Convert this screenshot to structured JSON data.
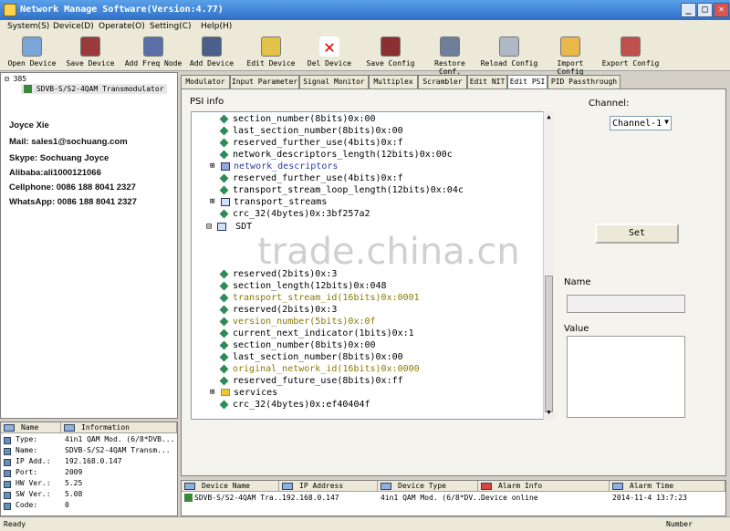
{
  "window": {
    "title": "Network Manage Software(Version:4.77)"
  },
  "menu": [
    "System(S)",
    "Device(D)",
    "Operate(O)",
    "Setting(C)",
    "Help(H)"
  ],
  "toolbar": [
    {
      "label": "Open Device",
      "icon": "open-device-icon"
    },
    {
      "label": "Save Device",
      "icon": "save-device-icon"
    },
    {
      "label": "Add Freq Node",
      "icon": "add-freq-node-icon"
    },
    {
      "label": "Add Device",
      "icon": "add-device-icon"
    },
    {
      "label": "Edit Device",
      "icon": "edit-device-icon"
    },
    {
      "label": "Del Device",
      "icon": "delete-icon"
    },
    {
      "label": "Save Config",
      "icon": "save-config-icon"
    },
    {
      "label": "Restore Conf.",
      "icon": "restore-config-icon"
    },
    {
      "label": "Reload Config",
      "icon": "reload-config-icon"
    },
    {
      "label": "Import Config",
      "icon": "import-config-icon"
    },
    {
      "label": "Export Config",
      "icon": "export-config-icon"
    }
  ],
  "device_tree": {
    "root": "385",
    "child": "SDVB-S/S2-4QAM Transmodulator"
  },
  "contact": {
    "name": "Joyce Xie",
    "mail": "Mail: sales1@sochuang.com",
    "skype": "Skype: Sochuang Joyce",
    "alibaba": "Alibaba:ali1000121066",
    "cellphone": "Cellphone: 0086 188 8041 2327",
    "whatsapp": "WhatsApp: 0086 188 8041 2327"
  },
  "info_table": {
    "headers": [
      "Name",
      "Information"
    ],
    "rows": [
      [
        "Type:",
        "4in1 QAM Mod. (6/8*DVB..."
      ],
      [
        "Name:",
        "SDVB-S/S2-4QAM Transm..."
      ],
      [
        "IP Add.:",
        "192.168.0.147"
      ],
      [
        "Port:",
        "2009"
      ],
      [
        "HW Ver.:",
        "5.25"
      ],
      [
        "SW Ver.:",
        "5.08"
      ],
      [
        "Code:",
        "0"
      ]
    ]
  },
  "tabs": [
    "Modulator",
    "Input Parameter",
    "Signal Monitor",
    "Multiplex",
    "Scrambler",
    "Edit NIT",
    "Edit PSI",
    "PID Passthrough"
  ],
  "psi": {
    "label": "PSI info",
    "lines_top": [
      {
        "text": "section_number(8bits)0x:00",
        "kind": "leaf",
        "color": "#000"
      },
      {
        "text": "last_section_number(8bits)0x:00",
        "kind": "leaf",
        "color": "#000"
      },
      {
        "text": "reserved_further_use(4bits)0x:f",
        "kind": "leaf",
        "color": "#000"
      },
      {
        "text": "network_descriptors_length(12bits)0x:00c",
        "kind": "leaf",
        "color": "#000"
      },
      {
        "text": "network_descriptors",
        "kind": "group",
        "color": "#2a3f9a"
      },
      {
        "text": "reserved_further_use(4bits)0x:f",
        "kind": "leaf",
        "color": "#000"
      },
      {
        "text": "transport_stream_loop_length(12bits)0x:04c",
        "kind": "leaf",
        "color": "#000"
      },
      {
        "text": "transport_streams",
        "kind": "table",
        "color": "#000"
      },
      {
        "text": "crc_32(4bytes)0x:3bf257a2",
        "kind": "leaf",
        "color": "#000"
      }
    ],
    "sdt_label": "SDT",
    "lines_bottom": [
      {
        "text": "reserved(2bits)0x:3",
        "kind": "leaf",
        "color": "#000"
      },
      {
        "text": "section_length(12bits)0x:048",
        "kind": "leaf",
        "color": "#000"
      },
      {
        "text": "transport_stream_id(16bits)0x:0001",
        "kind": "leaf",
        "color": "#8a7a00"
      },
      {
        "text": "reserved(2bits)0x:3",
        "kind": "leaf",
        "color": "#000"
      },
      {
        "text": "version_number(5bits)0x:0f",
        "kind": "leaf",
        "color": "#8a7a00"
      },
      {
        "text": "current_next_indicator(1bits)0x:1",
        "kind": "leaf",
        "color": "#000"
      },
      {
        "text": "section_number(8bits)0x:00",
        "kind": "leaf",
        "color": "#000"
      },
      {
        "text": "last_section_number(8bits)0x:00",
        "kind": "leaf",
        "color": "#000"
      },
      {
        "text": "original_network_id(16bits)0x:0000",
        "kind": "leaf",
        "color": "#8a7a00"
      },
      {
        "text": "reserved_future_use(8bits)0x:ff",
        "kind": "leaf",
        "color": "#000"
      },
      {
        "text": "services",
        "kind": "folder",
        "color": "#000"
      },
      {
        "text": "crc_32(4bytes)0x:ef40404f",
        "kind": "leaf",
        "color": "#000"
      }
    ]
  },
  "side_panel": {
    "channel_label": "Channel:",
    "channel_value": "Channel-1",
    "set_button": "Set",
    "name_label": "Name",
    "value_label": "Value"
  },
  "watermark": "trade.china.cn",
  "device_list": {
    "headers": [
      "Device Name",
      "IP Address",
      "Device Type",
      "Alarm Info",
      "Alarm Time"
    ],
    "row": [
      "SDVB-S/S2-4QAM Tra...",
      "192.168.0.147",
      "4in1 QAM Mod. (6/8*DV...",
      "Device online",
      "2014-11-4 13:7:23"
    ]
  },
  "status": {
    "left": "Ready",
    "right": "Number"
  }
}
